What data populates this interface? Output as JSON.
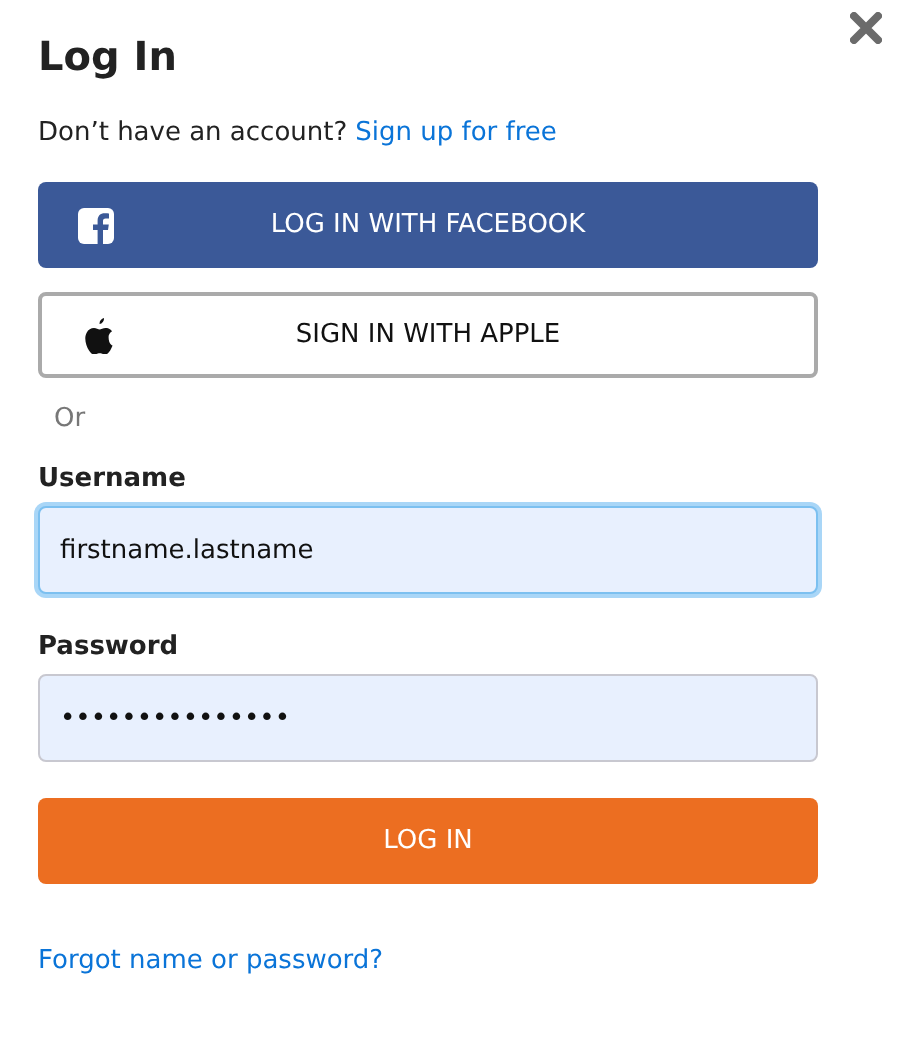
{
  "title": "Log In",
  "signup_prompt": {
    "text": "Don’t have an account?",
    "link": "Sign up for free"
  },
  "social_buttons": [
    {
      "kind": "facebook",
      "label": "LOG IN WITH FACEBOOK"
    },
    {
      "kind": "apple",
      "label": "SIGN IN WITH APPLE"
    }
  ],
  "separator": "Or",
  "fields": [
    {
      "label": "Username",
      "value": "firstname.lastname",
      "focused": true
    },
    {
      "label": "Password",
      "value": "•••••••••••••••",
      "focused": false
    }
  ],
  "submit": "LOG IN",
  "forgot_link": "Forgot name or password?"
}
